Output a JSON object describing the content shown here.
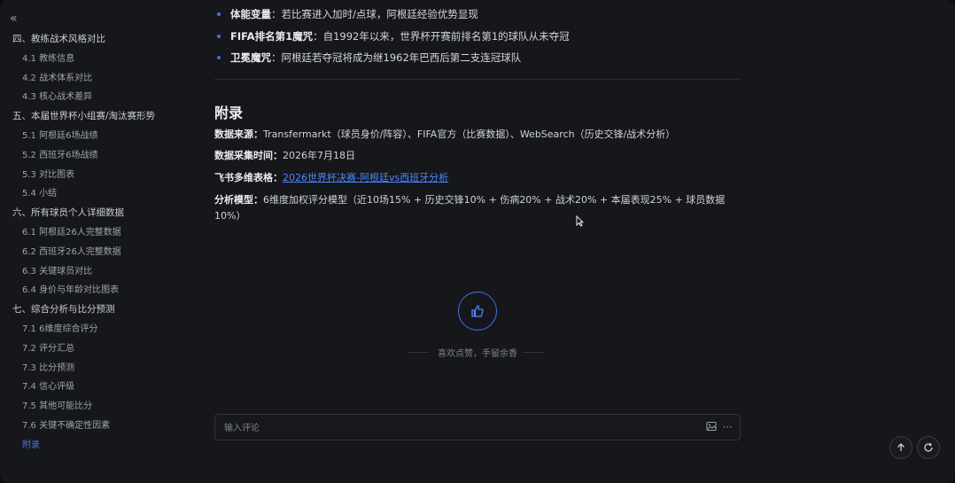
{
  "sidebar": {
    "items": [
      {
        "label": "四、教练战术风格对比",
        "level": 1
      },
      {
        "label": "4.1 教练信息",
        "level": 2
      },
      {
        "label": "4.2 战术体系对比",
        "level": 2
      },
      {
        "label": "4.3 核心战术差异",
        "level": 2
      },
      {
        "label": "五、本届世界杯小组赛/淘汰赛形势",
        "level": 1
      },
      {
        "label": "5.1 阿根廷6场战绩",
        "level": 2
      },
      {
        "label": "5.2 西班牙6场战绩",
        "level": 2
      },
      {
        "label": "5.3 对比图表",
        "level": 2
      },
      {
        "label": "5.4 小结",
        "level": 2
      },
      {
        "label": "六、所有球员个人详细数据",
        "level": 1
      },
      {
        "label": "6.1 阿根廷26人完整数据",
        "level": 2
      },
      {
        "label": "6.2 西班牙26人完整数据",
        "level": 2
      },
      {
        "label": "6.3 关键球员对比",
        "level": 2
      },
      {
        "label": "6.4 身价与年龄对比图表",
        "level": 2
      },
      {
        "label": "七、综合分析与比分预测",
        "level": 1
      },
      {
        "label": "7.1 6维度综合评分",
        "level": 2
      },
      {
        "label": "7.2 评分汇总",
        "level": 2
      },
      {
        "label": "7.3 比分预测",
        "level": 2
      },
      {
        "label": "7.4 信心评级",
        "level": 2
      },
      {
        "label": "7.5 其他可能比分",
        "level": 2
      },
      {
        "label": "7.6 关键不确定性因素",
        "level": 2
      },
      {
        "label": "附录",
        "level": 2,
        "active": true
      }
    ]
  },
  "main": {
    "bullets": [
      {
        "title": "体能变量",
        "text": "：若比赛进入加时/点球，阿根廷经验优势显现"
      },
      {
        "title": "FIFA排名第1魔咒",
        "text": "：自1992年以来，世界杯开赛前排名第1的球队从未夺冠"
      },
      {
        "title": "卫冕魔咒",
        "text": "：阿根廷若夺冠将成为继1962年巴西后第二支连冠球队"
      }
    ],
    "appendix": {
      "title": "附录",
      "source_label": "数据来源：",
      "source_text": "Transfermarkt（球员身价/阵容）、FIFA官方（比赛数据）、WebSearch（历史交锋/战术分析）",
      "time_label": "数据采集时间：",
      "time_text": "2026年7月18日",
      "table_label": "飞书多维表格：",
      "table_link": "2026世界杯决赛-阿根廷vs西班牙分析",
      "model_label": "分析模型：",
      "model_text": "6维度加权评分模型（近10场15% + 历史交锋10% + 伤病20% + 战术20% + 本届表现25% + 球员数据10%）"
    },
    "like_text": "喜欢点赞，手留余香",
    "comment_placeholder": "输入评论"
  },
  "colors": {
    "accent": "#3d72e6",
    "link": "#4a86ff",
    "background": "#16171a"
  }
}
